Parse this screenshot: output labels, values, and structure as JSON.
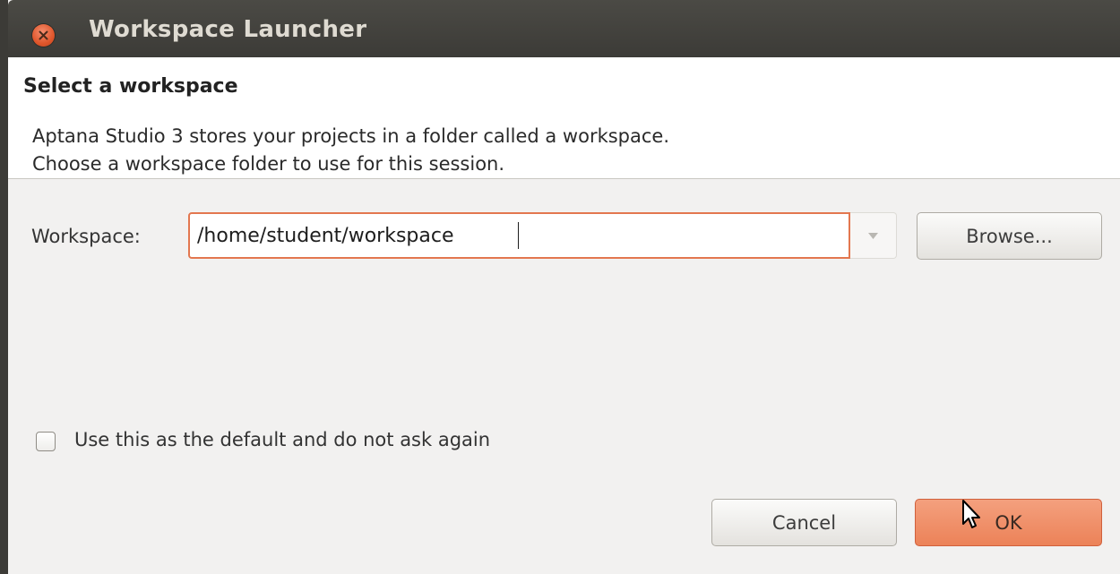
{
  "window": {
    "title": "Workspace Launcher"
  },
  "header": {
    "title": "Select a workspace",
    "line1": "Aptana Studio 3 stores your projects in a folder called a workspace.",
    "line2": "Choose a workspace folder to use for this session."
  },
  "workspace": {
    "label": "Workspace:",
    "value": "/home/student/workspace",
    "browse_label": "Browse..."
  },
  "options": {
    "default_checkbox_label": "Use this as the default and do not ask again",
    "default_checked": false
  },
  "buttons": {
    "cancel_label": "Cancel",
    "ok_label": "OK"
  },
  "colors": {
    "accent": "#e3774f",
    "titlebar": "#3c3b37",
    "ok_button": "#f09070"
  }
}
